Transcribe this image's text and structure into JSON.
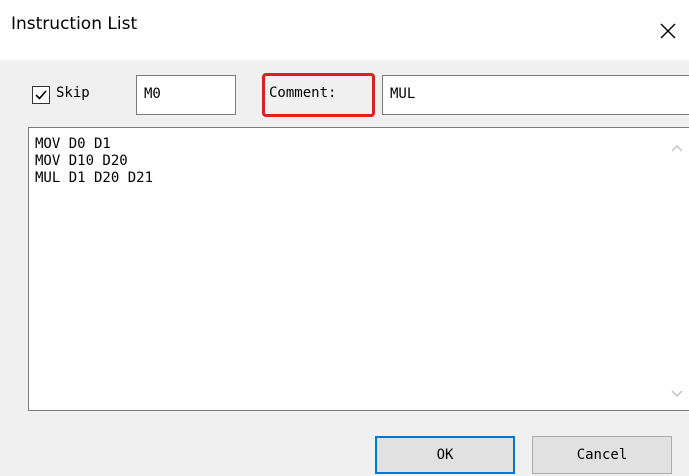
{
  "window": {
    "title": "Instruction List"
  },
  "skip": {
    "label": "Skip",
    "checked": true,
    "value": "M0"
  },
  "comment": {
    "label": "Comment:",
    "value": "MUL",
    "highlight_color": "#e02020"
  },
  "instructions": {
    "lines": [
      "MOV D0 D1",
      "MOV D10 D20",
      "MUL D1 D20 D21"
    ]
  },
  "buttons": {
    "ok_label": "OK",
    "cancel_label": "Cancel"
  },
  "icons": {
    "close": "close-icon",
    "check": "checkmark-icon",
    "scroll_up": "chevron-up-icon",
    "scroll_down": "chevron-down-icon"
  }
}
